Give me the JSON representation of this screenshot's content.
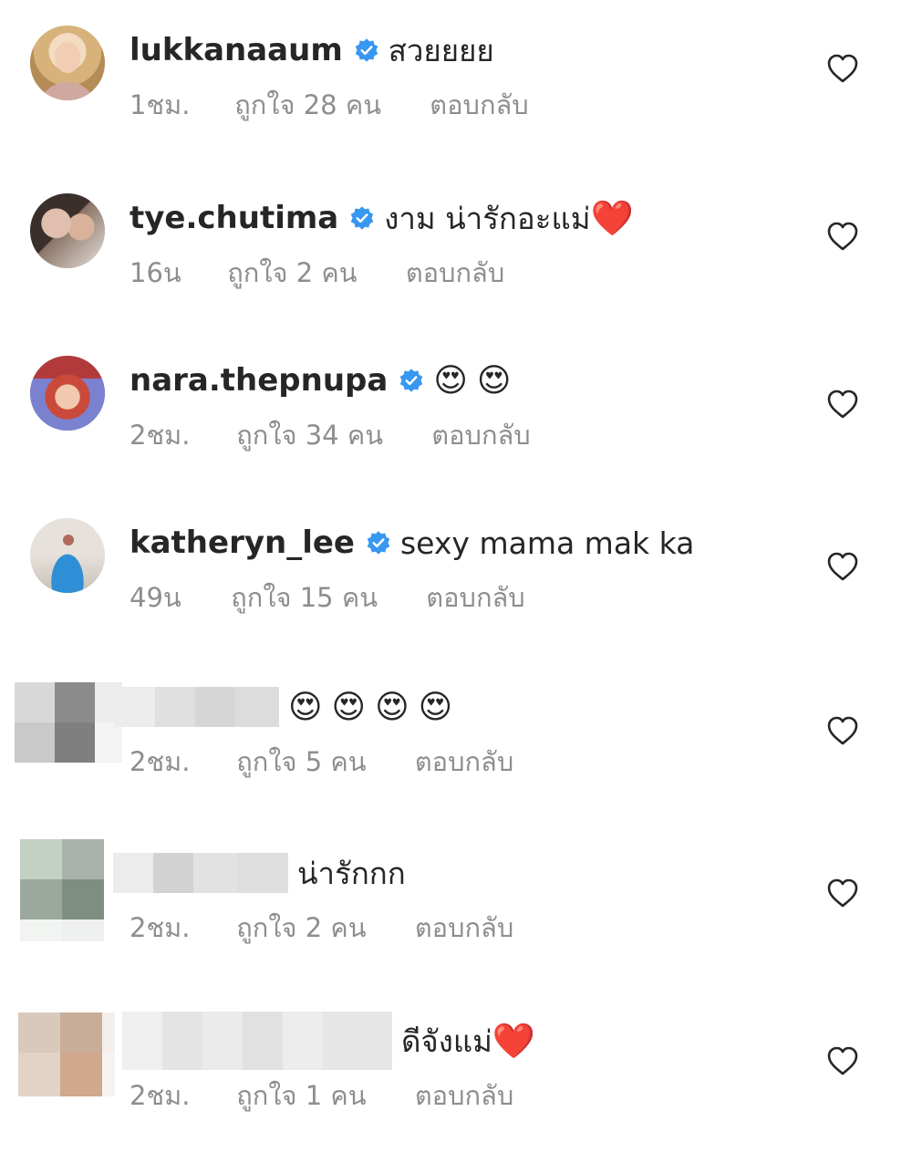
{
  "comments": [
    {
      "username": "lukkanaaum",
      "verified": true,
      "text": "สวยยยย",
      "time": "1ชม.",
      "likes": "ถูกใจ 28 คน",
      "reply": "ตอบกลับ"
    },
    {
      "username": "tye.chutima",
      "verified": true,
      "text": "งาม น่ารักอะแม่",
      "emoji": "❤️",
      "time": "16น",
      "likes": "ถูกใจ 2 คน",
      "reply": "ตอบกลับ"
    },
    {
      "username": "nara.thepnupa",
      "verified": true,
      "emoji": [
        "😍",
        "😍"
      ],
      "time": "2ชม.",
      "likes": "ถูกใจ 34 คน",
      "reply": "ตอบกลับ"
    },
    {
      "username": "katheryn_lee",
      "verified": true,
      "text": "sexy mama mak ka",
      "time": "49น",
      "likes": "ถูกใจ 15 คน",
      "reply": "ตอบกลับ"
    },
    {
      "username_blurred": true,
      "emoji": [
        "😍",
        "😍",
        "😍",
        "😍"
      ],
      "time": "2ชม.",
      "likes": "ถูกใจ 5 คน",
      "reply": "ตอบกลับ"
    },
    {
      "username_blurred": true,
      "text": "น่ารักกก",
      "time": "2ชม.",
      "likes": "ถูกใจ 2 คน",
      "reply": "ตอบกลับ"
    },
    {
      "username_blurred": true,
      "text": "ดีจังแม่",
      "emoji": "❤️",
      "time": "2ชม.",
      "likes": "ถูกใจ 1 คน",
      "reply": "ตอบกลับ"
    }
  ],
  "icons": {
    "verified_badge": "verified-badge-icon",
    "like": "heart-outline-icon"
  },
  "colors": {
    "verified_blue": "#3897f0",
    "meta_gray": "#8e8e8e",
    "text": "#262626"
  }
}
